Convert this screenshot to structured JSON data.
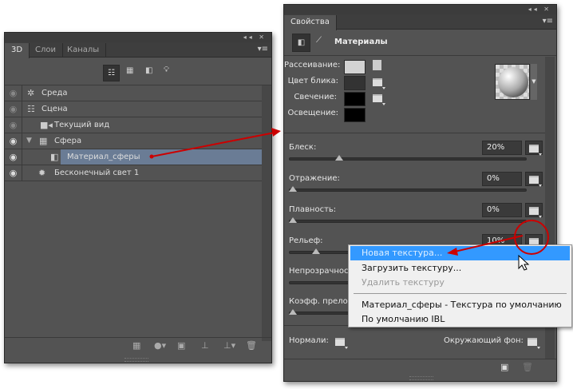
{
  "left_panel": {
    "tabs": [
      "3D",
      "Слои",
      "Каналы"
    ],
    "titlebar_controls": "◂◂ ✕",
    "rows": [
      {
        "label": "Среда",
        "icon": "environment-icon",
        "visible": false
      },
      {
        "label": "Сцена",
        "icon": "scene-icon",
        "visible": false
      },
      {
        "label": "Текущий вид",
        "icon": "camera-icon",
        "visible": false
      },
      {
        "label": "Сфера",
        "icon": "mesh-icon",
        "visible": true,
        "expanded": true
      },
      {
        "label": "Материал_сферы",
        "icon": "material-icon",
        "visible": true,
        "selected": true
      },
      {
        "label": "Бесконечный свет 1",
        "icon": "light-icon",
        "visible": true
      }
    ]
  },
  "right_panel": {
    "tab": "Свойства",
    "titlebar_controls": "◂◂ ✕",
    "section_title": "Материалы",
    "colors": [
      {
        "label": "Рассеивание:",
        "color": "#d3d3d3"
      },
      {
        "label": "Цвет блика:",
        "color": "#333333"
      },
      {
        "label": "Свечение:",
        "color": "#000000"
      },
      {
        "label": "Освещение:",
        "color": "#000000"
      }
    ],
    "sliders": [
      {
        "label": "Блеск:",
        "value": "20%",
        "percent": 20
      },
      {
        "label": "Отражение:",
        "value": "0%",
        "percent": 0
      },
      {
        "label": "Плавность:",
        "value": "0%",
        "percent": 0
      },
      {
        "label": "Рельеф:",
        "value": "10%",
        "percent": 10
      },
      {
        "label": "Непрозрачность:",
        "value": "",
        "percent": 100
      },
      {
        "label": "Коэфф. преломления:",
        "value": "",
        "percent": 0
      }
    ],
    "normals_label": "Нормали:",
    "environment_label": "Окружающий фон:"
  },
  "context_menu": {
    "items": [
      "Новая текстура...",
      "Загрузить текстуру...",
      "Удалить текстуру",
      "Материал_сферы - Текстура по умолчанию",
      "По умолчанию IBL"
    ]
  }
}
